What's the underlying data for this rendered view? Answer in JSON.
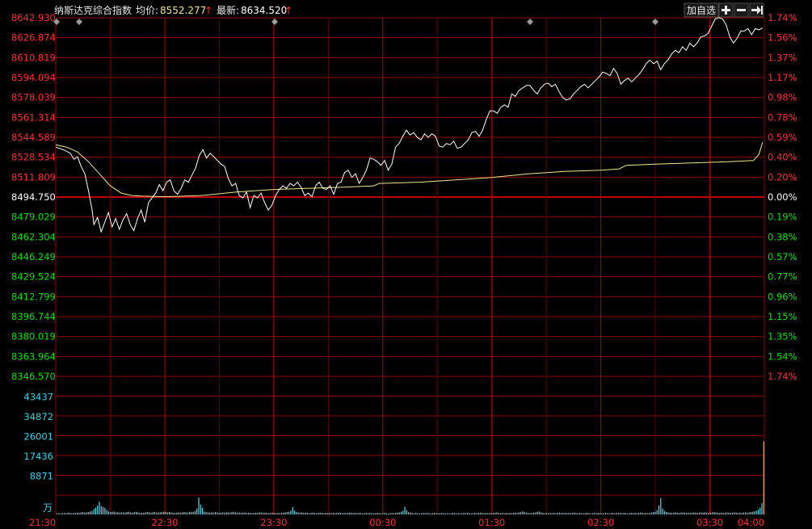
{
  "header": {
    "index_name": "纳斯达克综合指数",
    "avg_label": "均价:",
    "avg_value": "8552.277",
    "last_label": "最新:",
    "last_value": "8634.520",
    "add_watchlist_label": "加自选",
    "zoom_in_icon": "plus-icon",
    "zoom_out_icon": "minus-icon",
    "exit_icon": "exit-arrow-icon"
  },
  "colors": {
    "up": "#ff3030",
    "down": "#00e000",
    "neutral": "#ffffff",
    "grid": "#8b0000",
    "price_line": "#ffffff",
    "avg_line": "#f0e68c",
    "volume_label": "#3ccfe8",
    "volume_bar": "#5fd7e6",
    "last_bar": "#f0c040"
  },
  "chart_data": {
    "type": "line",
    "title": "纳斯达克综合指数",
    "y_left_ticks": [
      {
        "label": "8642.930",
        "tone": "up"
      },
      {
        "label": "8626.874",
        "tone": "up"
      },
      {
        "label": "8610.819",
        "tone": "up"
      },
      {
        "label": "8594.094",
        "tone": "up"
      },
      {
        "label": "8578.039",
        "tone": "up"
      },
      {
        "label": "8561.314",
        "tone": "up"
      },
      {
        "label": "8544.589",
        "tone": "up"
      },
      {
        "label": "8528.534",
        "tone": "up"
      },
      {
        "label": "8511.809",
        "tone": "up"
      },
      {
        "label": "8494.750",
        "tone": "neutral"
      },
      {
        "label": "8479.029",
        "tone": "down"
      },
      {
        "label": "8462.304",
        "tone": "down"
      },
      {
        "label": "8446.249",
        "tone": "down"
      },
      {
        "label": "8429.524",
        "tone": "down"
      },
      {
        "label": "8412.799",
        "tone": "down"
      },
      {
        "label": "8396.744",
        "tone": "down"
      },
      {
        "label": "8380.019",
        "tone": "down"
      },
      {
        "label": "8363.964",
        "tone": "down"
      },
      {
        "label": "8346.570",
        "tone": "down"
      }
    ],
    "y_right_ticks": [
      {
        "label": "1.74%",
        "tone": "up"
      },
      {
        "label": "1.56%",
        "tone": "up"
      },
      {
        "label": "1.37%",
        "tone": "up"
      },
      {
        "label": "1.17%",
        "tone": "up"
      },
      {
        "label": "0.98%",
        "tone": "up"
      },
      {
        "label": "0.78%",
        "tone": "up"
      },
      {
        "label": "0.59%",
        "tone": "up"
      },
      {
        "label": "0.40%",
        "tone": "up"
      },
      {
        "label": "0.20%",
        "tone": "up"
      },
      {
        "label": "0.00%",
        "tone": "neutral"
      },
      {
        "label": "0.19%",
        "tone": "down"
      },
      {
        "label": "0.38%",
        "tone": "down"
      },
      {
        "label": "0.57%",
        "tone": "down"
      },
      {
        "label": "0.77%",
        "tone": "down"
      },
      {
        "label": "0.96%",
        "tone": "down"
      },
      {
        "label": "1.15%",
        "tone": "down"
      },
      {
        "label": "1.35%",
        "tone": "down"
      },
      {
        "label": "1.54%",
        "tone": "down"
      },
      {
        "label": "1.74%",
        "tone": "up"
      }
    ],
    "ylim": [
      8346.57,
      8642.93
    ],
    "prev_close": 8494.75,
    "x_ticks": [
      "21:30",
      "22:30",
      "23:30",
      "00:30",
      "01:30",
      "02:30",
      "03:30",
      "04:00"
    ],
    "x_range_minutes": 390,
    "volume_unit": "万",
    "volume_ticks": [
      "43437",
      "34872",
      "26001",
      "17436",
      "8871"
    ],
    "volume_max": 52000,
    "price_series": {
      "name": "",
      "points": [
        [
          0,
          8536
        ],
        [
          4,
          8534
        ],
        [
          8,
          8531
        ],
        [
          10,
          8526
        ],
        [
          12,
          8528
        ],
        [
          14,
          8520
        ],
        [
          16,
          8514
        ],
        [
          18,
          8500
        ],
        [
          20,
          8484
        ],
        [
          21,
          8472
        ],
        [
          23,
          8478
        ],
        [
          25,
          8466
        ],
        [
          27,
          8474
        ],
        [
          29,
          8482
        ],
        [
          31,
          8470
        ],
        [
          33,
          8477
        ],
        [
          35,
          8468
        ],
        [
          37,
          8476
        ],
        [
          39,
          8481
        ],
        [
          41,
          8472
        ],
        [
          43,
          8467
        ],
        [
          45,
          8477
        ],
        [
          47,
          8484
        ],
        [
          49,
          8474
        ],
        [
          51,
          8490
        ],
        [
          53,
          8494
        ],
        [
          55,
          8498
        ],
        [
          57,
          8505
        ],
        [
          59,
          8500
        ],
        [
          61,
          8507
        ],
        [
          63,
          8509
        ],
        [
          65,
          8500
        ],
        [
          67,
          8497
        ],
        [
          69,
          8502
        ],
        [
          71,
          8509
        ],
        [
          73,
          8507
        ],
        [
          75,
          8513
        ],
        [
          77,
          8519
        ],
        [
          79,
          8529
        ],
        [
          81,
          8534
        ],
        [
          83,
          8527
        ],
        [
          85,
          8531
        ],
        [
          87,
          8528
        ],
        [
          89,
          8525
        ],
        [
          91,
          8522
        ],
        [
          93,
          8520
        ],
        [
          95,
          8510
        ],
        [
          97,
          8504
        ],
        [
          99,
          8506
        ],
        [
          101,
          8496
        ],
        [
          103,
          8494
        ],
        [
          105,
          8499
        ],
        [
          107,
          8486
        ],
        [
          109,
          8496
        ],
        [
          111,
          8494
        ],
        [
          113,
          8498
        ],
        [
          115,
          8490
        ],
        [
          117,
          8484
        ],
        [
          119,
          8488
        ],
        [
          121,
          8496
        ],
        [
          123,
          8501
        ],
        [
          125,
          8504
        ],
        [
          127,
          8502
        ],
        [
          129,
          8506
        ],
        [
          131,
          8504
        ],
        [
          133,
          8507
        ],
        [
          135,
          8503
        ],
        [
          137,
          8496
        ],
        [
          139,
          8498
        ],
        [
          141,
          8495
        ],
        [
          143,
          8504
        ],
        [
          145,
          8507
        ],
        [
          147,
          8502
        ],
        [
          149,
          8501
        ],
        [
          151,
          8504
        ],
        [
          153,
          8497
        ],
        [
          155,
          8506
        ],
        [
          157,
          8507
        ],
        [
          159,
          8515
        ],
        [
          161,
          8517
        ],
        [
          163,
          8511
        ],
        [
          165,
          8514
        ],
        [
          167,
          8506
        ],
        [
          169,
          8511
        ],
        [
          171,
          8517
        ],
        [
          173,
          8527
        ],
        [
          175,
          8526
        ],
        [
          177,
          8524
        ],
        [
          179,
          8521
        ],
        [
          181,
          8525
        ],
        [
          183,
          8517
        ],
        [
          185,
          8522
        ],
        [
          187,
          8536
        ],
        [
          189,
          8539
        ],
        [
          191,
          8545
        ],
        [
          193,
          8550
        ],
        [
          195,
          8546
        ],
        [
          197,
          8548
        ],
        [
          199,
          8544
        ],
        [
          201,
          8542
        ],
        [
          203,
          8547
        ],
        [
          205,
          8544
        ],
        [
          207,
          8547
        ],
        [
          209,
          8545
        ],
        [
          211,
          8537
        ],
        [
          213,
          8536
        ],
        [
          215,
          8539
        ],
        [
          217,
          8538
        ],
        [
          219,
          8541
        ],
        [
          221,
          8535
        ],
        [
          223,
          8536
        ],
        [
          225,
          8539
        ],
        [
          227,
          8542
        ],
        [
          229,
          8548
        ],
        [
          231,
          8549
        ],
        [
          233,
          8545
        ],
        [
          235,
          8550
        ],
        [
          237,
          8559
        ],
        [
          239,
          8566
        ],
        [
          241,
          8566
        ],
        [
          243,
          8564
        ],
        [
          245,
          8569
        ],
        [
          247,
          8571
        ],
        [
          249,
          8569
        ],
        [
          251,
          8580
        ],
        [
          253,
          8578
        ],
        [
          255,
          8583
        ],
        [
          257,
          8585
        ],
        [
          259,
          8587
        ],
        [
          261,
          8587
        ],
        [
          263,
          8583
        ],
        [
          265,
          8580
        ],
        [
          267,
          8585
        ],
        [
          269,
          8588
        ],
        [
          271,
          8589
        ],
        [
          273,
          8586
        ],
        [
          275,
          8588
        ],
        [
          277,
          8582
        ],
        [
          279,
          8577
        ],
        [
          281,
          8575
        ],
        [
          283,
          8576
        ],
        [
          285,
          8580
        ],
        [
          287,
          8583
        ],
        [
          289,
          8586
        ],
        [
          291,
          8588
        ],
        [
          293,
          8585
        ],
        [
          295,
          8588
        ],
        [
          297,
          8591
        ],
        [
          299,
          8594
        ],
        [
          301,
          8598
        ],
        [
          303,
          8597
        ],
        [
          305,
          8595
        ],
        [
          307,
          8601
        ],
        [
          309,
          8597
        ],
        [
          311,
          8588
        ],
        [
          313,
          8591
        ],
        [
          315,
          8593
        ],
        [
          317,
          8590
        ],
        [
          319,
          8593
        ],
        [
          321,
          8596
        ],
        [
          323,
          8600
        ],
        [
          325,
          8605
        ],
        [
          327,
          8608
        ],
        [
          329,
          8605
        ],
        [
          331,
          8607
        ],
        [
          333,
          8600
        ],
        [
          335,
          8605
        ],
        [
          337,
          8608
        ],
        [
          339,
          8613
        ],
        [
          341,
          8616
        ],
        [
          343,
          8614
        ],
        [
          345,
          8619
        ],
        [
          347,
          8616
        ],
        [
          349,
          8622
        ],
        [
          351,
          8619
        ],
        [
          353,
          8622
        ],
        [
          355,
          8627
        ],
        [
          357,
          8628
        ],
        [
          359,
          8630
        ],
        [
          361,
          8636
        ],
        [
          363,
          8642
        ],
        [
          365,
          8643
        ],
        [
          367,
          8642
        ],
        [
          369,
          8637
        ],
        [
          371,
          8627
        ],
        [
          373,
          8622
        ],
        [
          375,
          8626
        ],
        [
          377,
          8632
        ],
        [
          379,
          8632
        ],
        [
          381,
          8634
        ],
        [
          383,
          8629
        ],
        [
          385,
          8634
        ],
        [
          387,
          8633
        ],
        [
          389,
          8634.52
        ]
      ]
    },
    "avg_series": {
      "name": "",
      "points": [
        [
          0,
          8538
        ],
        [
          6,
          8536
        ],
        [
          12,
          8532
        ],
        [
          18,
          8524
        ],
        [
          24,
          8514
        ],
        [
          30,
          8504
        ],
        [
          36,
          8498
        ],
        [
          42,
          8496
        ],
        [
          48,
          8495.5
        ],
        [
          60,
          8495
        ],
        [
          80,
          8496
        ],
        [
          100,
          8499
        ],
        [
          120,
          8501
        ],
        [
          140,
          8502
        ],
        [
          160,
          8503
        ],
        [
          175,
          8504
        ],
        [
          178,
          8506
        ],
        [
          200,
          8507
        ],
        [
          220,
          8509
        ],
        [
          240,
          8511
        ],
        [
          260,
          8514
        ],
        [
          280,
          8516
        ],
        [
          300,
          8517
        ],
        [
          310,
          8518
        ],
        [
          314,
          8521
        ],
        [
          330,
          8522
        ],
        [
          350,
          8523
        ],
        [
          370,
          8524
        ],
        [
          384,
          8525
        ],
        [
          387,
          8530
        ],
        [
          389,
          8540
        ]
      ]
    },
    "volume": [
      0.4,
      0.5,
      0.4,
      0.5,
      0.6,
      0.5,
      0.7,
      0.6,
      0.5,
      0.6,
      0.5,
      0.7,
      0.6,
      0.8,
      0.9,
      0.7,
      0.8,
      0.9,
      1.1,
      1.3,
      2.0,
      2.6,
      3.4,
      4.8,
      3.2,
      2.8,
      2.5,
      1.7,
      1.2,
      0.9,
      1.0,
      1.1,
      0.8,
      0.9,
      0.7,
      0.8,
      0.8,
      0.7,
      0.9,
      1.0,
      0.8,
      0.7,
      0.9,
      1.0,
      0.8,
      0.6,
      0.7,
      0.6,
      0.8,
      0.9,
      0.8,
      0.7,
      0.8,
      0.9,
      0.7,
      0.8,
      0.8,
      0.9,
      1.0,
      0.9,
      0.8,
      0.9,
      0.8,
      0.7,
      0.6,
      0.7,
      0.8,
      0.7,
      0.8,
      0.9,
      0.8,
      0.7,
      0.9,
      1.0,
      0.9,
      1.3,
      2.2,
      6.4,
      3.7,
      2.5,
      1.1,
      0.9,
      0.8,
      0.7,
      0.8,
      0.7,
      0.9,
      0.8,
      0.6,
      0.7,
      0.8,
      0.7,
      0.8,
      0.8,
      0.7,
      0.9,
      1.0,
      0.8,
      0.7,
      0.8,
      0.6,
      0.7,
      0.8,
      0.6,
      0.7,
      0.6,
      0.5,
      0.6,
      0.7,
      0.6,
      0.8,
      0.7,
      0.6,
      0.7,
      0.6,
      0.5,
      0.6,
      0.7,
      0.6,
      0.5,
      0.6,
      0.5,
      0.6,
      0.7,
      0.8,
      0.9,
      1.0,
      1.4,
      2.8,
      1.5,
      0.9,
      0.8,
      0.7,
      0.8,
      0.6,
      0.7,
      0.6,
      0.5,
      0.6,
      0.7,
      0.6,
      0.5,
      0.6,
      0.7,
      0.6,
      0.5,
      0.6,
      0.5,
      0.6,
      0.5,
      0.6,
      0.5,
      0.6,
      0.7,
      0.6,
      0.5,
      0.6,
      0.5,
      0.6,
      0.7,
      0.6,
      0.5,
      0.6,
      0.5,
      0.6,
      0.5,
      0.4,
      0.5,
      0.6,
      0.5,
      0.6,
      0.5,
      0.4,
      0.5,
      0.6,
      0.5,
      0.4,
      0.5,
      0.6,
      0.5,
      0.4,
      0.5,
      0.6,
      0.5,
      0.6,
      0.7,
      0.8,
      1.0,
      1.4,
      2.9,
      1.6,
      0.9,
      0.7,
      0.6,
      0.5,
      0.6,
      0.5,
      0.4,
      0.5,
      0.6,
      0.5,
      0.6,
      0.5,
      0.4,
      0.5,
      0.6,
      0.5,
      0.4,
      0.5,
      0.6,
      0.5,
      0.4,
      0.5,
      0.4,
      0.5,
      0.6,
      0.5,
      0.4,
      0.5,
      0.4,
      0.5,
      0.6,
      0.5,
      0.6,
      0.5,
      0.4,
      0.5,
      0.6,
      0.5,
      0.6,
      0.7,
      0.6,
      0.5,
      0.6,
      0.5,
      0.6,
      0.5,
      0.6,
      0.7,
      0.8,
      0.6,
      0.5,
      0.6,
      0.5,
      0.6,
      0.5,
      0.6,
      0.5,
      0.6,
      0.7,
      0.6,
      0.8,
      0.9,
      1.2,
      0.9,
      0.7,
      0.6,
      0.5,
      0.6,
      0.7,
      0.8,
      1.0,
      1.1,
      0.8,
      0.6,
      0.5,
      0.6,
      0.5,
      0.6,
      0.5,
      0.6,
      0.5,
      0.6,
      0.7,
      0.6,
      0.5,
      0.6,
      0.5,
      0.6,
      0.5,
      0.6,
      0.7,
      0.6,
      0.5,
      0.6,
      0.5,
      0.4,
      0.5,
      0.6,
      0.5,
      0.4,
      0.5,
      0.6,
      0.5,
      0.6,
      0.5,
      0.4,
      0.5,
      0.6,
      0.5,
      0.4,
      0.5,
      0.6,
      0.5,
      0.6,
      0.5,
      0.6,
      0.5,
      0.6,
      0.5,
      0.4,
      0.5,
      0.6,
      0.5,
      0.6,
      0.5,
      0.6,
      0.7,
      0.6,
      0.5,
      0.6,
      0.5,
      0.6,
      0.7,
      0.9,
      1.0,
      1.6,
      3.4,
      6.2,
      2.2,
      1.3,
      0.9,
      0.8,
      0.7,
      0.6,
      0.7,
      0.8,
      0.7,
      0.6,
      0.7,
      0.8,
      0.7,
      0.6,
      0.7,
      0.6,
      0.7,
      0.8,
      0.7,
      0.6,
      0.7,
      0.8,
      0.7,
      0.8,
      0.7,
      0.6,
      0.7,
      0.8,
      0.9,
      0.8,
      0.7,
      0.6,
      0.7,
      0.6,
      0.7,
      0.8,
      0.7,
      0.6,
      0.7,
      0.8,
      0.7,
      0.6,
      0.7,
      0.6,
      0.7,
      0.8,
      0.7,
      0.8,
      0.9,
      1.0,
      1.2,
      1.4,
      1.8,
      2.6,
      4.2,
      27.5
    ],
    "volume_scale_note": "",
    "grid": true,
    "legend": ""
  }
}
